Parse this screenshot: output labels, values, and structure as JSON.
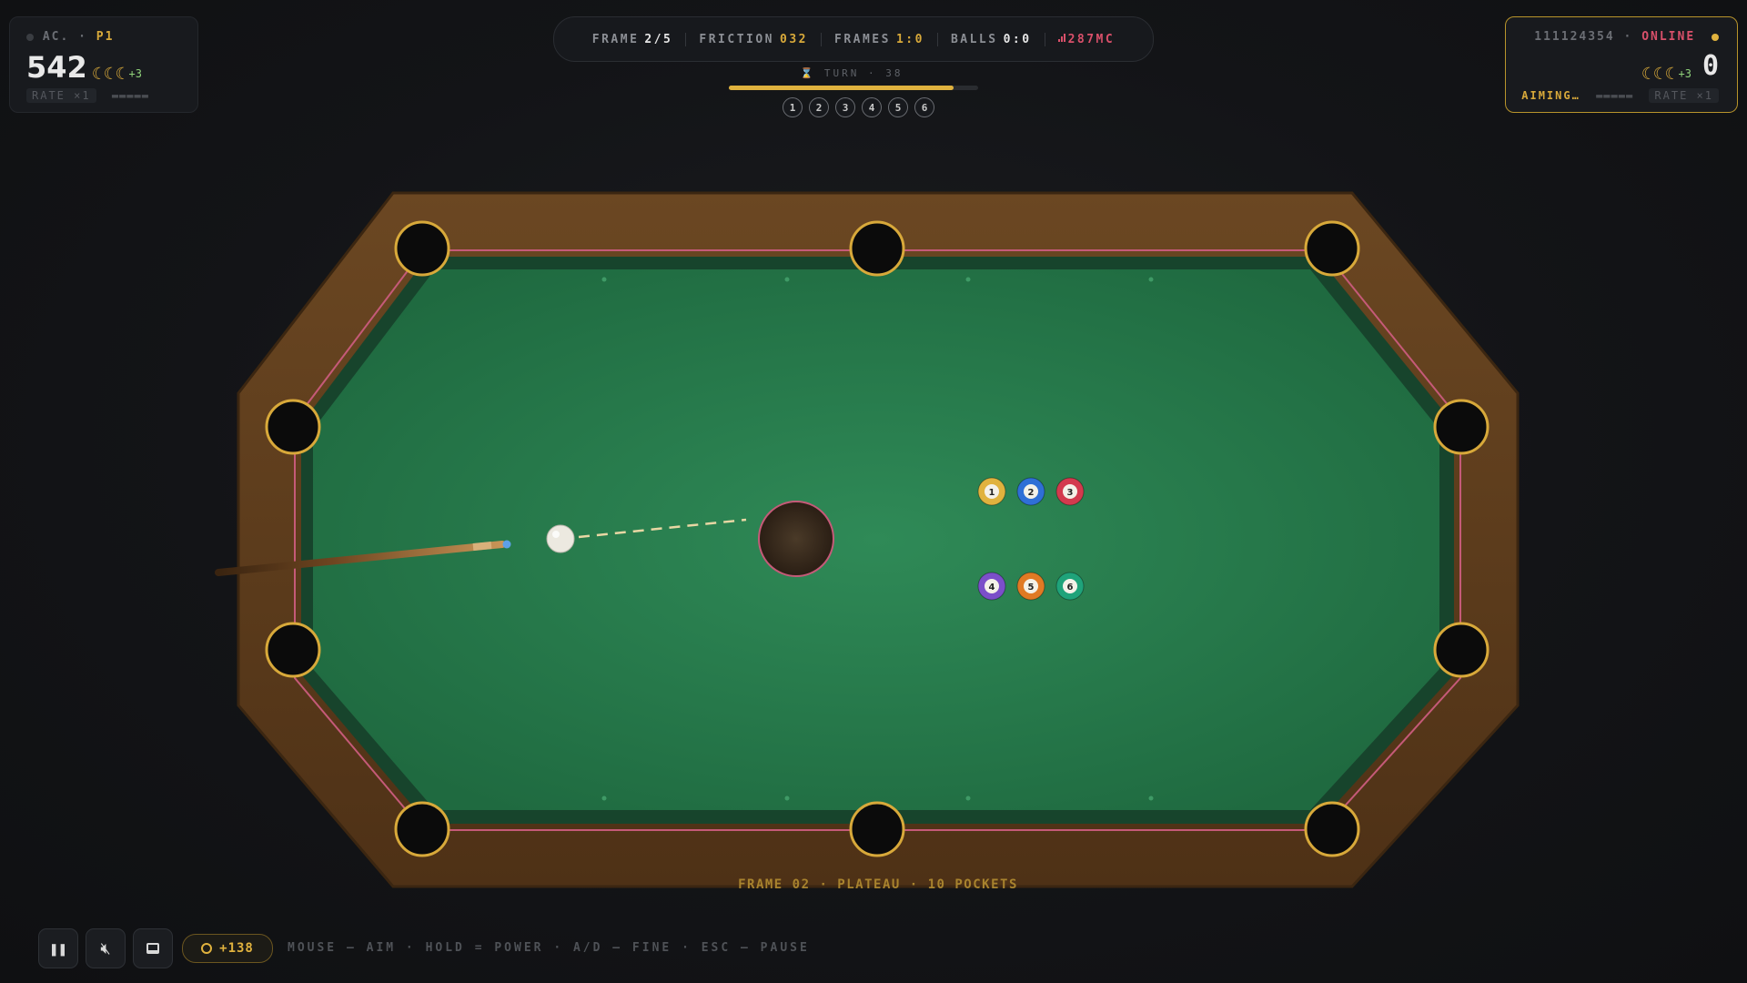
{
  "player1": {
    "label": "AC.",
    "tag": "P1",
    "score": "542",
    "bonus": "+3",
    "rate": "RATE ×1"
  },
  "player2": {
    "id": "111124354",
    "status": "ONLINE",
    "score": "0",
    "bonus": "+3",
    "state": "AIMING…",
    "rate": "RATE ×1"
  },
  "hud": {
    "frame_label": "FRAME",
    "frame_value": "2/5",
    "friction_label": "FRICTION",
    "friction_value": "032",
    "frames_label": "FRAMES",
    "frames_value": "1:0",
    "balls_label": "BALLS",
    "balls_value": "0:0",
    "ping": "287MC",
    "turn": "TURN · 38",
    "turn_progress": 0.9,
    "rack_numbers": [
      "1",
      "2",
      "3",
      "4",
      "5",
      "6"
    ]
  },
  "table": {
    "caption": "FRAME 02 · PLATEAU · 10 POCKETS",
    "balls": [
      {
        "number": "1",
        "color": "#e0b23e"
      },
      {
        "number": "2",
        "color": "#2f6fd6"
      },
      {
        "number": "3",
        "color": "#d33a4e"
      },
      {
        "number": "4",
        "color": "#7b4fc9"
      },
      {
        "number": "5",
        "color": "#e07a24"
      },
      {
        "number": "6",
        "color": "#1fa37a"
      }
    ]
  },
  "footer": {
    "coins": "+138",
    "hint": "MOUSE — AIM · HOLD = POWER · A/D — FINE · ESC — PAUSE"
  },
  "colors": {
    "accent": "#d8a93a",
    "felt": "#2a7a4e",
    "rail": "#5a3a1c",
    "alert": "#d9506a"
  },
  "icons": {
    "pause": "pause-icon",
    "mute": "mute-icon",
    "screen": "screen-icon",
    "coin": "coin-icon"
  }
}
